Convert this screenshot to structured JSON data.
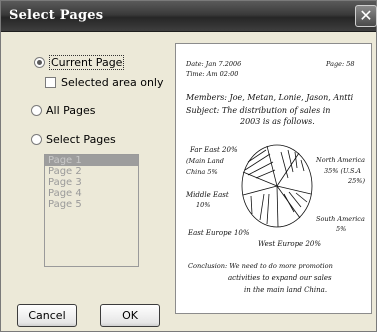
{
  "window": {
    "title": "Select Pages",
    "close_glyph": "✕"
  },
  "options": {
    "current_page": "Current Page",
    "selected_area_only": "Selected area only",
    "all_pages": "All Pages",
    "select_pages": "Select Pages"
  },
  "page_list": [
    "Page 1",
    "Page 2",
    "Page 3",
    "Page 4",
    "Page 5"
  ],
  "buttons": {
    "cancel": "Cancel",
    "ok": "OK"
  },
  "note": {
    "date": "Date: Jan 7.2006",
    "time": "Time: Am 02:00",
    "page": "Page: 58",
    "members_1": "Members: Joe, Metan, Lonie, Jason, Antti",
    "subject_1": "Subject: The distribution of sales in",
    "subject_2": "2003 is as follows.",
    "far_east_1": "Far East 20%",
    "far_east_2": "(Main Land",
    "far_east_3": "China 5%",
    "north_america_1": "North America",
    "north_america_2": "35% (U.S.A",
    "north_america_3": "25%)",
    "middle_east_1": "Middle East",
    "middle_east_2": "10%",
    "south_america_1": "South America",
    "south_america_2": "5%",
    "east_europe": "East Europe 10%",
    "west_europe": "West Europe 20%",
    "conclusion_1": "Conclusion: We need to do more promotion",
    "conclusion_2": "activities to expand our sales",
    "conclusion_3": "in the main land China."
  }
}
